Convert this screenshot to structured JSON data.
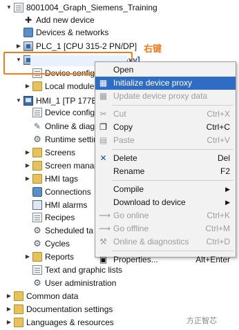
{
  "annotation": "右键",
  "watermark": "方正智芯",
  "tree": [
    {
      "label": "8001004_Graph_Siemens_Training",
      "arrow": "▼",
      "icon": "doc",
      "level": 0
    },
    {
      "label": "Add new device",
      "arrow": "",
      "icon": "add",
      "level": 1
    },
    {
      "label": "Devices & networks",
      "arrow": "",
      "icon": "net",
      "level": 1
    },
    {
      "label": "PLC_1 [CPU 315-2 PN/DP]",
      "arrow": "▶",
      "icon": "plc",
      "level": 1
    },
    {
      "label": "PLC_Proxy [Device Proxy]",
      "arrow": "▼",
      "icon": "plc",
      "level": 1
    },
    {
      "label": "Device configu",
      "arrow": "",
      "icon": "doc",
      "level": 2
    },
    {
      "label": "Local modules",
      "arrow": "▶",
      "icon": "folder",
      "level": 2
    },
    {
      "label": "HMI_1 [TP 177B",
      "arrow": "▼",
      "icon": "hmi",
      "level": 1
    },
    {
      "label": "Device configu",
      "arrow": "",
      "icon": "doc",
      "level": 2
    },
    {
      "label": "Online & diagn",
      "arrow": "",
      "icon": "wrench",
      "level": 2
    },
    {
      "label": "Runtime settin",
      "arrow": "",
      "icon": "gear",
      "level": 2
    },
    {
      "label": "Screens",
      "arrow": "▶",
      "icon": "folder",
      "level": 2
    },
    {
      "label": "Screen manag",
      "arrow": "▶",
      "icon": "folder",
      "level": 2
    },
    {
      "label": "HMI tags",
      "arrow": "▶",
      "icon": "folder",
      "level": 2
    },
    {
      "label": "Connections",
      "arrow": "",
      "icon": "net",
      "level": 2
    },
    {
      "label": "HMI alarms",
      "arrow": "",
      "icon": "scr",
      "level": 2
    },
    {
      "label": "Recipes",
      "arrow": "",
      "icon": "doc",
      "level": 2
    },
    {
      "label": "Scheduled ta",
      "arrow": "",
      "icon": "gear",
      "level": 2
    },
    {
      "label": "Cycles",
      "arrow": "",
      "icon": "gear",
      "level": 2
    },
    {
      "label": "Reports",
      "arrow": "▶",
      "icon": "folder",
      "level": 2
    },
    {
      "label": "Text and graphic lists",
      "arrow": "",
      "icon": "doc",
      "level": 2
    },
    {
      "label": "User administration",
      "arrow": "",
      "icon": "gear",
      "level": 2
    },
    {
      "label": "Common data",
      "arrow": "▶",
      "icon": "folder",
      "level": 0
    },
    {
      "label": "Documentation settings",
      "arrow": "▶",
      "icon": "folder",
      "level": 0
    },
    {
      "label": "Languages & resources",
      "arrow": "▶",
      "icon": "folder",
      "level": 0
    }
  ],
  "menu": {
    "items": [
      {
        "label": "Open",
        "key": "",
        "icon": "",
        "state": "normal"
      },
      {
        "label": "Initialize device proxy",
        "key": "",
        "icon": "▦",
        "state": "highlight"
      },
      {
        "label": "Update device proxy data",
        "key": "",
        "icon": "▦",
        "state": "disabled"
      },
      {
        "sep": true
      },
      {
        "label": "Cut",
        "key": "Ctrl+X",
        "icon": "✂",
        "state": "disabled"
      },
      {
        "label": "Copy",
        "key": "Ctrl+C",
        "icon": "❐",
        "state": "normal"
      },
      {
        "label": "Paste",
        "key": "Ctrl+V",
        "icon": "▤",
        "state": "disabled"
      },
      {
        "sep": true
      },
      {
        "label": "Delete",
        "key": "Del",
        "icon": "✕",
        "state": "normal"
      },
      {
        "label": "Rename",
        "key": "F2",
        "icon": "",
        "state": "normal"
      },
      {
        "sep": true
      },
      {
        "label": "Compile",
        "key": "",
        "icon": "",
        "state": "normal",
        "submenu": "▶"
      },
      {
        "label": "Download to device",
        "key": "",
        "icon": "",
        "state": "normal",
        "submenu": "▶"
      },
      {
        "label": "Go online",
        "key": "Ctrl+K",
        "icon": "⟿",
        "state": "disabled"
      },
      {
        "label": "Go offline",
        "key": "Ctrl+M",
        "icon": "⟿",
        "state": "disabled"
      },
      {
        "label": "Online & diagnostics",
        "key": "Ctrl+D",
        "icon": "⚒",
        "state": "disabled"
      },
      {
        "sep": true
      },
      {
        "label": "Properties...",
        "key": "Alt+Enter",
        "icon": "▣",
        "state": "normal"
      }
    ]
  }
}
